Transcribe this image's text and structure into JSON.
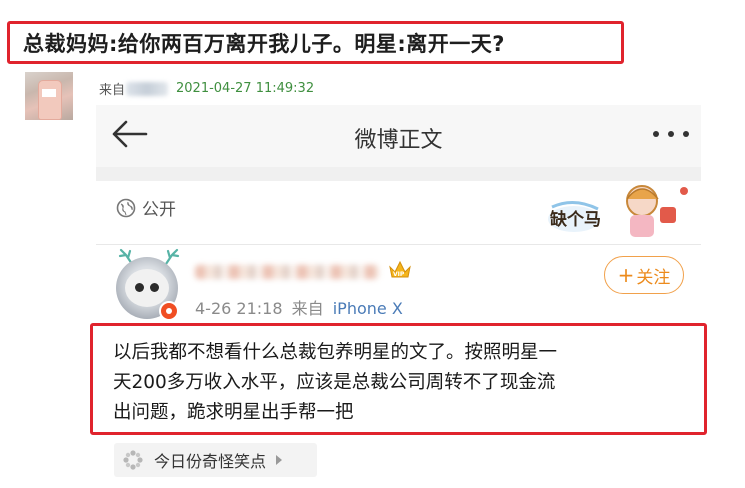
{
  "headline": {
    "text": "总裁妈妈:给你两百万离开我儿子。明星:离开一天?"
  },
  "post_meta": {
    "source_prefix": "来自",
    "timestamp": "2021-04-27 11:49:32"
  },
  "app": {
    "title": "微博正文",
    "visibility_label": "公开",
    "sticker_text": "缺个马",
    "post": {
      "date_time": "4-26 21:18",
      "source_prefix": "来自",
      "source_device": "iPhone X",
      "follow_label": "关注",
      "follow_icon": "+",
      "badge": "VIP",
      "content_lines": [
        "以后我都不想看什么总裁包养明星的文了。按照明星一",
        "天200多万收入水平，应该是总裁公司周转不了现金流",
        "出问题，跪求明星出手帮一把"
      ]
    },
    "topic_tag": "今日份奇怪笑点"
  },
  "colors": {
    "highlight_border": "#e0232d",
    "follow": "#ec8b1d",
    "timestamp": "#3f8f3f",
    "source_link": "#4a7bb7"
  }
}
